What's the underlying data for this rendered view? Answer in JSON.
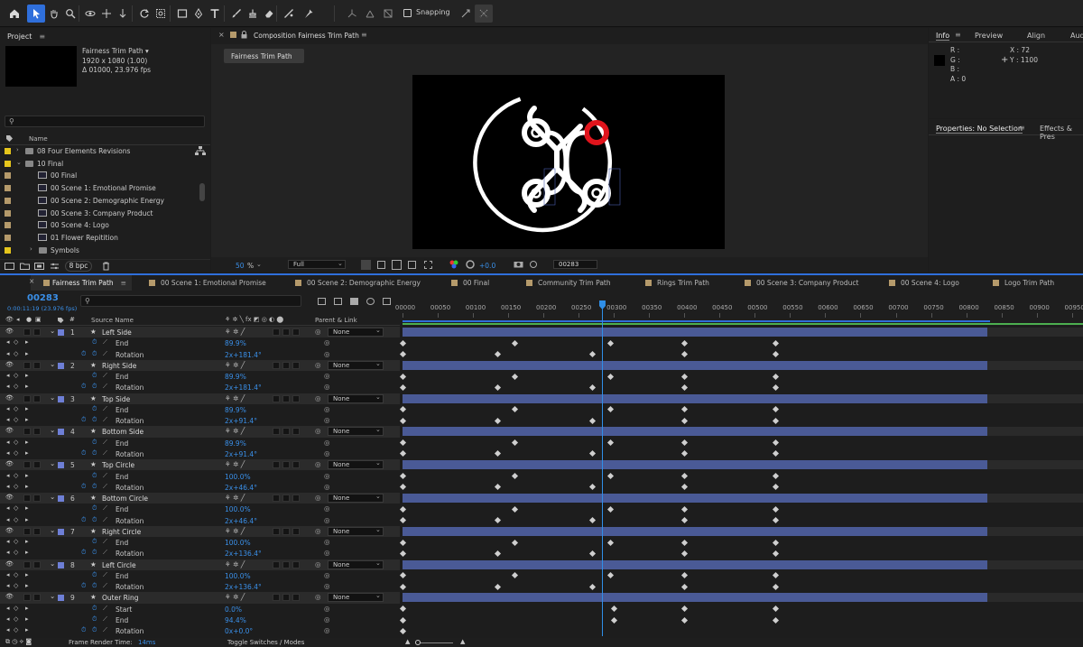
{
  "toolbar": {
    "snapping_label": "Snapping"
  },
  "project": {
    "title": "Project",
    "comp_name": "Fairness Trim Path ▾",
    "comp_res": "1920 x 1080 (1.00)",
    "comp_dur": "Δ 01000, 23.976 fps",
    "search_placeholder": "",
    "col_name": "Name",
    "items": [
      {
        "label": "08 Four Elements Revisions",
        "type": "folder",
        "color": "#e6c61c",
        "indent": 0,
        "expanded": false
      },
      {
        "label": "10 Final",
        "type": "folder",
        "color": "#e6c61c",
        "indent": 0,
        "expanded": true
      },
      {
        "label": "00 Final",
        "type": "comp",
        "color": "#b59a6b",
        "indent": 1
      },
      {
        "label": "00 Scene 1: Emotional Promise",
        "type": "comp",
        "color": "#b59a6b",
        "indent": 1
      },
      {
        "label": "00 Scene 2: Demographic Energy",
        "type": "comp",
        "color": "#b59a6b",
        "indent": 1
      },
      {
        "label": "00 Scene 3: Company Product",
        "type": "comp",
        "color": "#b59a6b",
        "indent": 1
      },
      {
        "label": "00 Scene 4: Logo",
        "type": "comp",
        "color": "#b59a6b",
        "indent": 1
      },
      {
        "label": "01 Flower Repitition",
        "type": "comp",
        "color": "#b59a6b",
        "indent": 1
      },
      {
        "label": "Symbols",
        "type": "folder",
        "color": "#e6c61c",
        "indent": 1,
        "expanded": false
      }
    ],
    "bpc": "8 bpc"
  },
  "composition": {
    "tab_label": "Composition Fairness Trim Path",
    "crumb": "Fairness Trim Path",
    "zoom": "50",
    "zoom_unit": "%",
    "quality": "Full",
    "exposure": "+0.0",
    "timecode": "00283"
  },
  "info": {
    "tabs": [
      "Info",
      "Preview",
      "Align",
      "Aud"
    ],
    "r": "R :",
    "g": "G :",
    "b": "B :",
    "a": "A : 0",
    "x": "X : 72",
    "y": "Y : 1100",
    "properties_tab": "Properties: No Selection",
    "effects_tab": "Effects & Pres"
  },
  "timeline": {
    "tabs": [
      "Fairness Trim Path",
      "00 Scene 1: Emotional Promise",
      "00 Scene 2: Demographic Energy",
      "00 Final",
      "Community Trim Path",
      "Rings Trim Path",
      "00 Scene 3: Company Product",
      "00 Scene 4: Logo",
      "Logo Trim Path"
    ],
    "current_frame": "00283",
    "current_time": "0:00:11:19 (23.976 fps)",
    "col_source": "Source Name",
    "col_parent": "Parent & Link",
    "none": "None",
    "ruler": [
      "00000",
      "00050",
      "00100",
      "00150",
      "00200",
      "00250",
      "00300",
      "00350",
      "00400",
      "00450",
      "00500",
      "00550",
      "00600",
      "00650",
      "00700",
      "00750",
      "00800",
      "00850",
      "00900",
      "00950"
    ],
    "playhead_frame": 283,
    "bar_end_frame": 830,
    "frame_render_label": "Frame Render Time:",
    "frame_render_value": "14ms",
    "toggle_label": "Toggle Switches / Modes",
    "layers": [
      {
        "num": "1",
        "name": "Left Side",
        "props": [
          {
            "name": "End",
            "value": "89.9%",
            "keys": [
              0,
              160,
              295,
              400,
              530
            ]
          },
          {
            "name": "Rotation",
            "value": "2x+181.4°",
            "keys": [
              0,
              135,
              270,
              400,
              530
            ]
          }
        ]
      },
      {
        "num": "2",
        "name": "Right Side",
        "props": [
          {
            "name": "End",
            "value": "89.9%",
            "keys": [
              0,
              160,
              295,
              400,
              530
            ]
          },
          {
            "name": "Rotation",
            "value": "2x+181.4°",
            "keys": [
              0,
              135,
              270,
              400,
              530
            ]
          }
        ]
      },
      {
        "num": "3",
        "name": "Top Side",
        "props": [
          {
            "name": "End",
            "value": "89.9%",
            "keys": [
              0,
              160,
              295,
              400,
              530
            ]
          },
          {
            "name": "Rotation",
            "value": "2x+91.4°",
            "keys": [
              0,
              135,
              270,
              400,
              530
            ]
          }
        ]
      },
      {
        "num": "4",
        "name": "Bottom Side",
        "props": [
          {
            "name": "End",
            "value": "89.9%",
            "keys": [
              0,
              160,
              295,
              400,
              530
            ]
          },
          {
            "name": "Rotation",
            "value": "2x+91.4°",
            "keys": [
              0,
              135,
              270,
              400,
              530
            ]
          }
        ]
      },
      {
        "num": "5",
        "name": "Top Circle",
        "props": [
          {
            "name": "End",
            "value": "100.0%",
            "keys": [
              0,
              160,
              295,
              400,
              530
            ]
          },
          {
            "name": "Rotation",
            "value": "2x+46.4°",
            "keys": [
              0,
              135,
              270,
              400,
              530
            ]
          }
        ]
      },
      {
        "num": "6",
        "name": "Bottom Circle",
        "props": [
          {
            "name": "End",
            "value": "100.0%",
            "keys": [
              0,
              160,
              295,
              400,
              530
            ]
          },
          {
            "name": "Rotation",
            "value": "2x+46.4°",
            "keys": [
              0,
              135,
              270,
              400,
              530
            ]
          }
        ]
      },
      {
        "num": "7",
        "name": "Right Circle",
        "props": [
          {
            "name": "End",
            "value": "100.0%",
            "keys": [
              0,
              160,
              295,
              400,
              530
            ]
          },
          {
            "name": "Rotation",
            "value": "2x+136.4°",
            "keys": [
              0,
              135,
              270,
              400,
              530
            ]
          }
        ]
      },
      {
        "num": "8",
        "name": "Left Circle",
        "props": [
          {
            "name": "End",
            "value": "100.0%",
            "keys": [
              0,
              160,
              295,
              400,
              530
            ]
          },
          {
            "name": "Rotation",
            "value": "2x+136.4°",
            "keys": [
              0,
              135,
              270,
              400,
              530
            ]
          }
        ]
      },
      {
        "num": "9",
        "name": "Outer Ring",
        "props": [
          {
            "name": "Start",
            "value": "0.0%",
            "keys": [
              0,
              300,
              400,
              530
            ]
          },
          {
            "name": "End",
            "value": "94.4%",
            "keys": [
              0,
              300,
              400,
              530
            ]
          },
          {
            "name": "Rotation",
            "value": "0x+0.0°",
            "keys": [
              0
            ]
          }
        ]
      }
    ]
  },
  "colors": {
    "accent": "#2f6fdb",
    "timecode": "#3a8fe8",
    "layer_bar": "#4a5a96",
    "label_blue": "#6e7fd6",
    "logo_red": "#e0141c"
  }
}
